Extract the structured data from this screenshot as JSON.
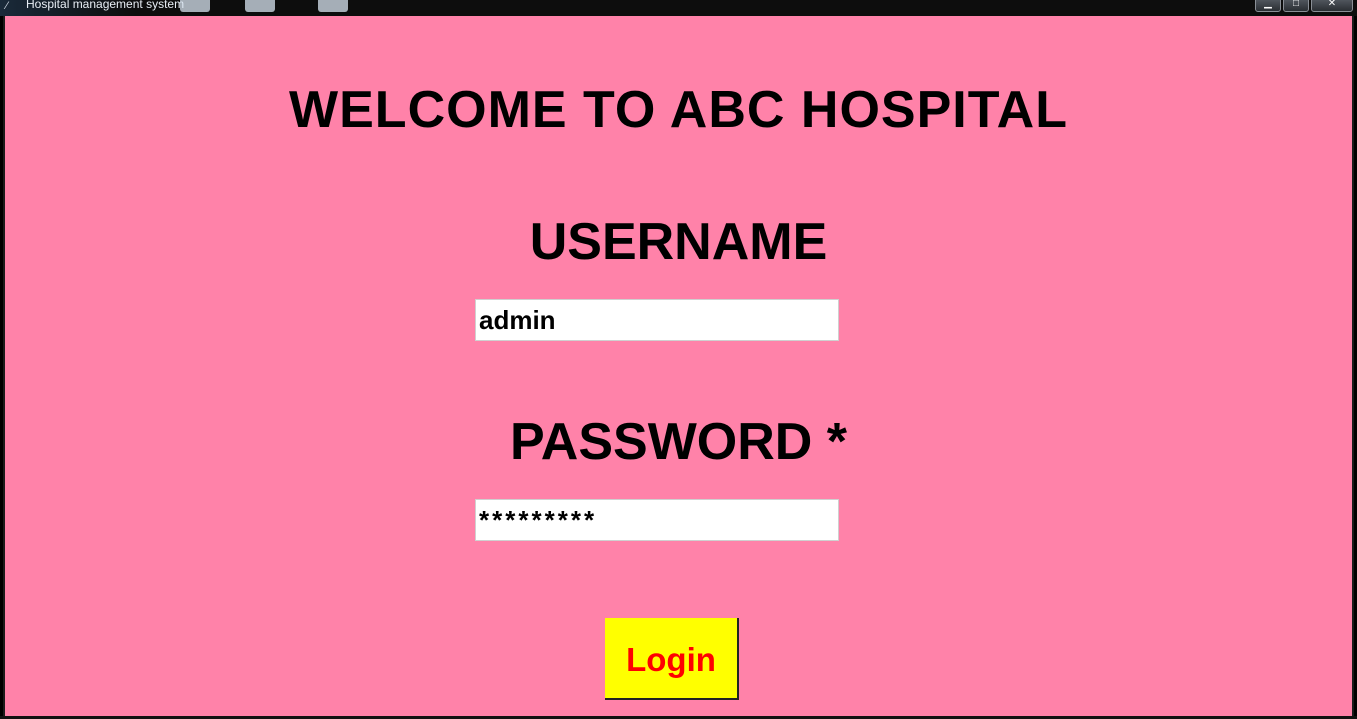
{
  "window": {
    "title": "Hospital management system",
    "controls": {
      "minimize": "▁",
      "maximize": "□",
      "close": "✕"
    },
    "background_color": "#ff82a9"
  },
  "form": {
    "welcome_text": "WELCOME TO ABC HOSPITAL",
    "username_label": "USERNAME",
    "username_value": "admin",
    "password_label": "PASSWORD *",
    "password_value": "*********",
    "login_button_label": "Login",
    "login_button_color": "#ffff00",
    "login_text_color": "#ff0000"
  }
}
